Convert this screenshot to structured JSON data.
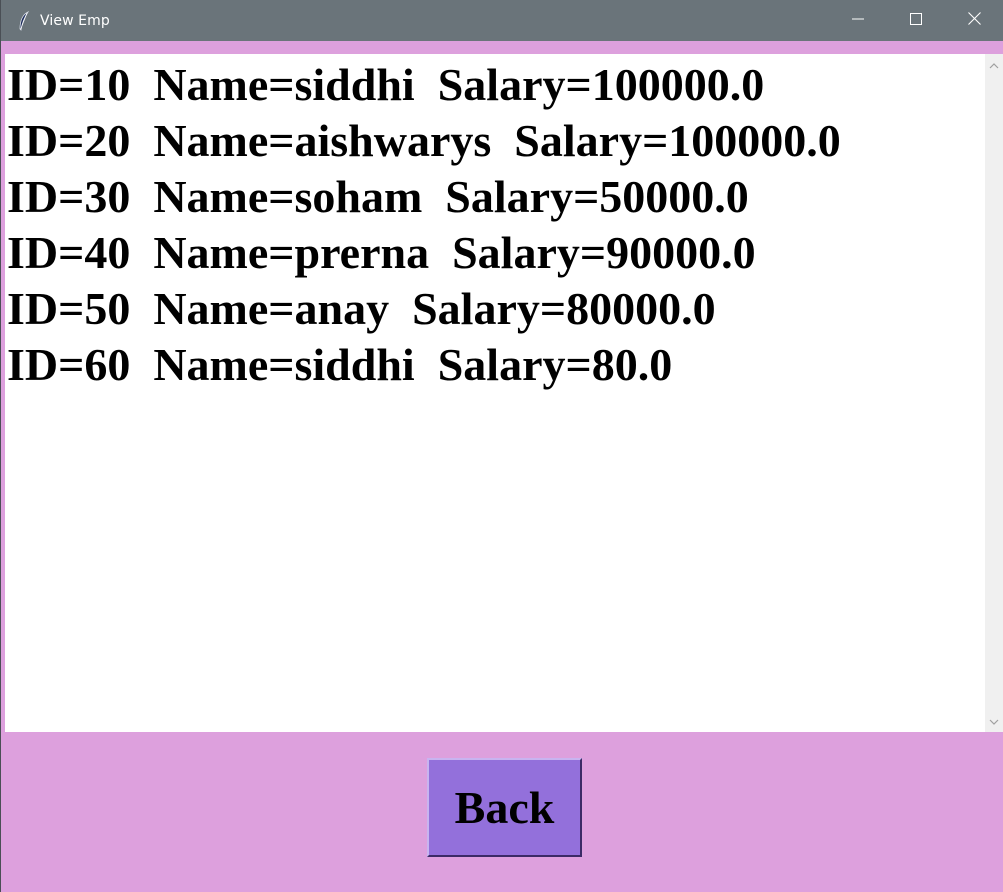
{
  "window": {
    "title": "View Emp",
    "app_icon": "feather-icon",
    "controls": {
      "minimize_icon": "minimize-icon",
      "maximize_icon": "maximize-icon",
      "close_icon": "close-icon"
    }
  },
  "records": [
    "ID=10  Name=siddhi  Salary=100000.0",
    "ID=20  Name=aishwarys  Salary=100000.0",
    "ID=30  Name=soham  Salary=50000.0",
    "ID=40  Name=prerna  Salary=90000.0",
    "ID=50  Name=anay  Salary=80000.0",
    "ID=60  Name=siddhi  Salary=80.0"
  ],
  "scrollbar": {
    "up_icon": "chevron-up-icon",
    "down_icon": "chevron-down-icon"
  },
  "footer": {
    "back_label": "Back"
  },
  "colors": {
    "background": "#dda0dd",
    "titlebar": "#6a747a",
    "button": "#9370db",
    "text_area": "#ffffff"
  }
}
